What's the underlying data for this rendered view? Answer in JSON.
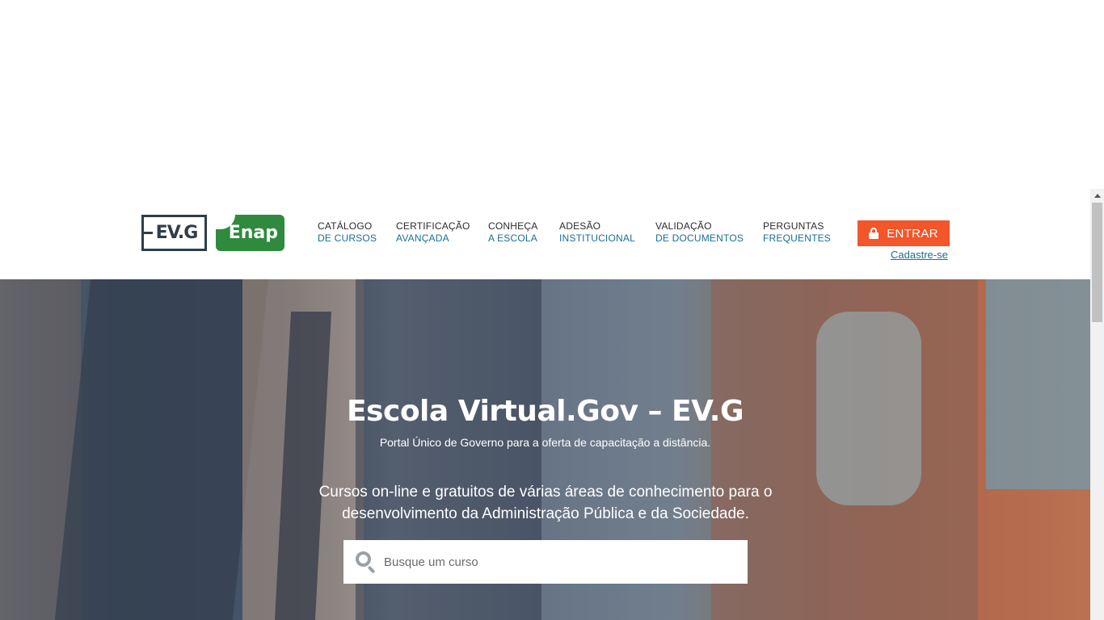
{
  "header": {
    "logo_evg": "EV.G",
    "logo_enap": "Enap",
    "nav": [
      {
        "line1": "CATÁLOGO",
        "line2": "DE CURSOS"
      },
      {
        "line1": "CERTIFICAÇÃO",
        "line2": "AVANÇADA"
      },
      {
        "line1": "CONHEÇA",
        "line2": "A ESCOLA"
      },
      {
        "line1": "ADESÃO",
        "line2": "INSTITUCIONAL"
      },
      {
        "line1": "VALIDAÇÃO",
        "line2": "DE DOCUMENTOS"
      },
      {
        "line1": "PERGUNTAS",
        "line2": "FREQUENTES"
      }
    ],
    "login_label": "ENTRAR",
    "signup_label": "Cadastre-se"
  },
  "hero": {
    "title": "Escola Virtual.Gov – EV.G",
    "subtitle": "Portal Único de Governo para a oferta de capacitação a distância.",
    "description": "Cursos on-line e gratuitos de várias áreas de conhecimento para o desenvolvimento da Administração Pública e da Sociedade.",
    "search_placeholder": "Busque um curso"
  },
  "colors": {
    "accent": "#f2562a",
    "nav_link": "#1a6f93",
    "enap_green": "#2f8a3e",
    "evg_dark": "#2f3e48"
  },
  "icons": {
    "login": "lock-icon",
    "search": "search-icon"
  }
}
